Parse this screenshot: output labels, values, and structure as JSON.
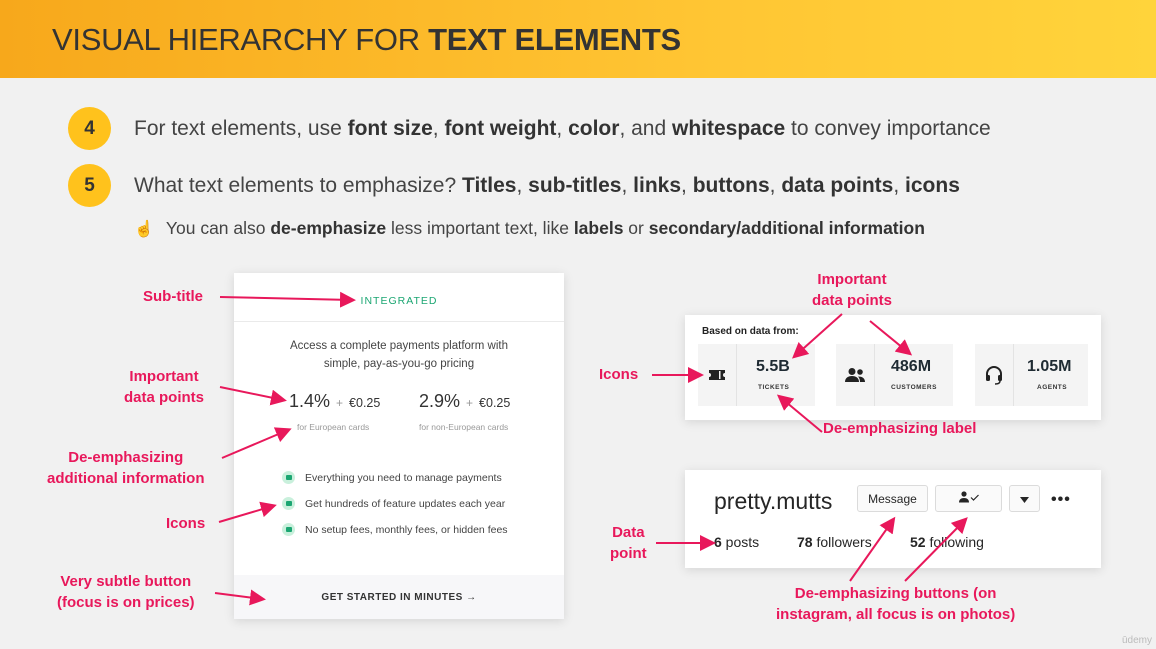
{
  "slide": {
    "title_prefix": "VISUAL HIERARCHY FOR ",
    "title_bold": "TEXT ELEMENTS",
    "watermark": "ūdemy"
  },
  "points": [
    {
      "number": "4",
      "segments": [
        {
          "t": "For text elements, use ",
          "b": false
        },
        {
          "t": "font size",
          "b": true
        },
        {
          "t": ", ",
          "b": false
        },
        {
          "t": "font weight",
          "b": true
        },
        {
          "t": ", ",
          "b": false
        },
        {
          "t": "color",
          "b": true
        },
        {
          "t": ", and ",
          "b": false
        },
        {
          "t": "whitespace",
          "b": true
        },
        {
          "t": " to convey importance",
          "b": false
        }
      ]
    },
    {
      "number": "5",
      "segments": [
        {
          "t": "What text elements to emphasize? ",
          "b": false
        },
        {
          "t": "Titles",
          "b": true
        },
        {
          "t": ", ",
          "b": false
        },
        {
          "t": "sub-titles",
          "b": true
        },
        {
          "t": ", ",
          "b": false
        },
        {
          "t": "links",
          "b": true
        },
        {
          "t": ", ",
          "b": false
        },
        {
          "t": "buttons",
          "b": true
        },
        {
          "t": ", ",
          "b": false
        },
        {
          "t": "data points",
          "b": true
        },
        {
          "t": ", ",
          "b": false
        },
        {
          "t": "icons",
          "b": true
        }
      ]
    }
  ],
  "subpoint": {
    "icon": "pointing-finger-icon",
    "segments": [
      {
        "t": "You can also ",
        "b": false
      },
      {
        "t": "de-emphasize",
        "b": true
      },
      {
        "t": " less important text, like ",
        "b": false
      },
      {
        "t": "labels",
        "b": true
      },
      {
        "t": " or ",
        "b": false
      },
      {
        "t": "secondary/additional information",
        "b": true
      }
    ]
  },
  "pricing_card": {
    "subtitle": "INTEGRATED",
    "description": "Access a complete payments platform with simple, pay-as-you-go pricing",
    "prices": [
      {
        "pct": "1.4%",
        "plus": "+",
        "fee": "€0.25",
        "note": "for European cards"
      },
      {
        "pct": "2.9%",
        "plus": "+",
        "fee": "€0.25",
        "note": "for non-European cards"
      }
    ],
    "features": [
      "Everything you need to manage payments",
      "Get hundreds of feature updates each year",
      "No setup fees, monthly fees, or hidden fees"
    ],
    "cta": "GET STARTED IN MINUTES →"
  },
  "data_card": {
    "header": "Based on data from:",
    "stats": [
      {
        "icon": "ticket-icon",
        "value": "5.5B",
        "label": "TICKETS"
      },
      {
        "icon": "users-icon",
        "value": "486M",
        "label": "CUSTOMERS"
      },
      {
        "icon": "headset-icon",
        "value": "1.05M",
        "label": "AGENTS"
      }
    ]
  },
  "insta_card": {
    "username": "pretty.mutts",
    "message_button": "Message",
    "follow_button_icon": "user-check-icon",
    "dropdown_icon": "caret-down-icon",
    "more": "•••",
    "stats": [
      {
        "num": "6",
        "label": " posts"
      },
      {
        "num": "78",
        "label": " followers"
      },
      {
        "num": "52",
        "label": " following"
      }
    ]
  },
  "annotations": {
    "subtitle": "Sub-title",
    "important_left_1": "Important",
    "important_left_2": "data points",
    "deemph_info_1": "De-emphasizing",
    "deemph_info_2": "additional information",
    "icons_left": "Icons",
    "subtle_1_bold": "Very subtle ",
    "subtle_1_rest": "button",
    "subtle_2": "(focus is on prices)",
    "important_right_1": "Important",
    "important_right_2": "data points",
    "icons_right": "Icons",
    "deemph_label_a": "De-emphasizing ",
    "deemph_label_b": "label",
    "data_point_1": "Data",
    "data_point_2": "point",
    "deemph_buttons_a": "De-emphasizing ",
    "deemph_buttons_b": "buttons",
    "deemph_buttons_c": " (on",
    "deemph_buttons_2": "instagram, all focus is on photos)"
  },
  "colors": {
    "accent": "#e8185b",
    "header_start": "#f7a81b",
    "header_end": "#ffd43b",
    "badge": "#ffc21c",
    "green": "#1ba672"
  }
}
